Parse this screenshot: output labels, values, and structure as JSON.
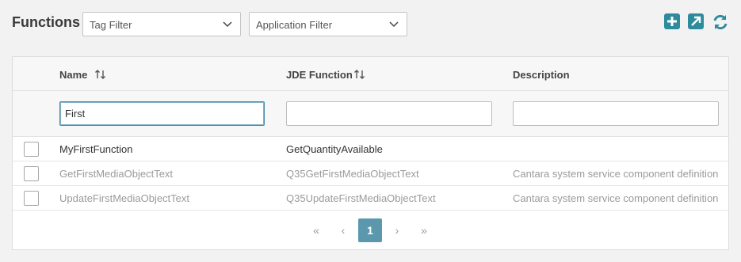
{
  "page": {
    "title": "Functions"
  },
  "filters": {
    "tag": "Tag Filter",
    "application": "Application Filter"
  },
  "toolbar": {
    "add": "add-icon",
    "export": "export-icon",
    "refresh": "refresh-icon"
  },
  "table": {
    "columns": [
      {
        "label": "Name",
        "sortable": true
      },
      {
        "label": "JDE Function",
        "sortable": true
      },
      {
        "label": "Description",
        "sortable": false
      }
    ],
    "filter_values": {
      "name": "First",
      "jde_function": "",
      "description": ""
    },
    "rows": [
      {
        "name": "MyFirstFunction",
        "jde_function": "GetQuantityAvailable",
        "description": "",
        "checked": false
      },
      {
        "name": "GetFirstMediaObjectText",
        "jde_function": "Q35GetFirstMediaObjectText",
        "description": "Cantara system service component definition",
        "checked": false
      },
      {
        "name": "UpdateFirstMediaObjectText",
        "jde_function": "Q35UpdateFirstMediaObjectText",
        "description": "Cantara system service component definition",
        "checked": false
      }
    ]
  },
  "pagination": {
    "first": "«",
    "prev": "‹",
    "current": "1",
    "next": "›",
    "last": "»"
  }
}
